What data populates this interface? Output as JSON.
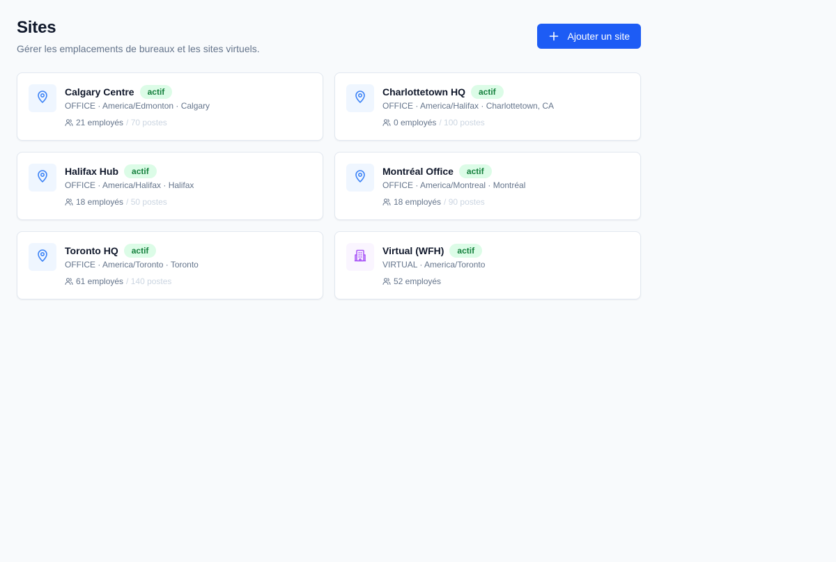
{
  "header": {
    "title": "Sites",
    "subtitle": "Gérer les emplacements de bureaux et les sites virtuels.",
    "add_label": "Ajouter un site"
  },
  "colors": {
    "primary": "#1d5cf5",
    "office_icon": "#3b82f6",
    "virtual_icon": "#a855f7",
    "badge_bg": "#dcfce7",
    "badge_text": "#15803d"
  },
  "sites": [
    {
      "name": "Calgary Centre",
      "status": "actif",
      "meta": "OFFICE · America/Edmonton · Calgary",
      "employees": "21 employés",
      "capacity": "/ 70 postes",
      "icon": "map-pin-icon"
    },
    {
      "name": "Charlottetown HQ",
      "status": "actif",
      "meta": "OFFICE · America/Halifax · Charlottetown, CA",
      "employees": "0 employés",
      "capacity": "/ 100 postes",
      "icon": "map-pin-icon"
    },
    {
      "name": "Halifax Hub",
      "status": "actif",
      "meta": "OFFICE · America/Halifax · Halifax",
      "employees": "18 employés",
      "capacity": "/ 50 postes",
      "icon": "map-pin-icon"
    },
    {
      "name": "Montréal Office",
      "status": "actif",
      "meta": "OFFICE · America/Montreal · Montréal",
      "employees": "18 employés",
      "capacity": "/ 90 postes",
      "icon": "map-pin-icon"
    },
    {
      "name": "Toronto HQ",
      "status": "actif",
      "meta": "OFFICE · America/Toronto · Toronto",
      "employees": "61 employés",
      "capacity": "/ 140 postes",
      "icon": "map-pin-icon"
    },
    {
      "name": "Virtual (WFH)",
      "status": "actif",
      "meta": "VIRTUAL · America/Toronto",
      "employees": "52 employés",
      "capacity": "",
      "icon": "building-icon"
    }
  ]
}
